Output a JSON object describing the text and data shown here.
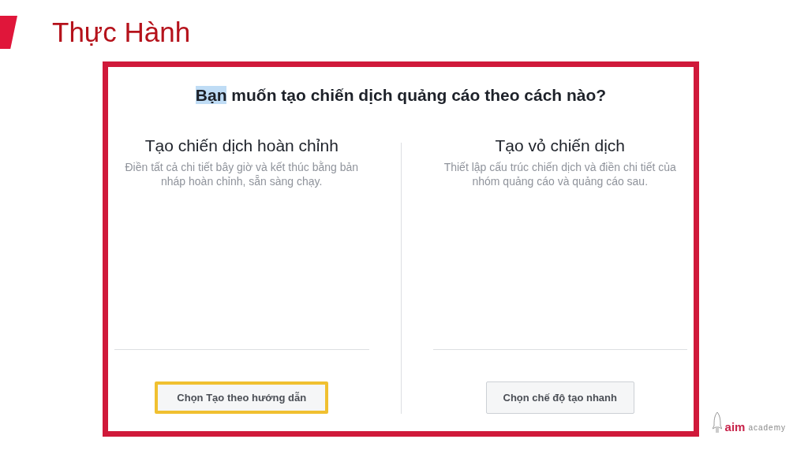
{
  "slide": {
    "title": "Thực Hành"
  },
  "dialog": {
    "question": {
      "highlighted": "Bạn",
      "rest": "muốn tạo chiến dịch quảng cáo theo cách nào?"
    },
    "options": [
      {
        "title": "Tạo chiến dịch hoàn chỉnh",
        "description": "Điền tất cả chi tiết bây giờ và kết thúc bằng bản nháp hoàn chỉnh, sẵn sàng chạy.",
        "button": "Chọn Tạo theo hướng dẫn",
        "selected": true
      },
      {
        "title": "Tạo vỏ chiến dịch",
        "description": "Thiết lập cấu trúc chiến dịch và điền chi tiết của nhóm quảng cáo và quảng cáo sau.",
        "button": "Chọn chế độ tạo nhanh",
        "selected": false
      }
    ]
  },
  "logo": {
    "brand": "aim",
    "suffix": "academy"
  }
}
